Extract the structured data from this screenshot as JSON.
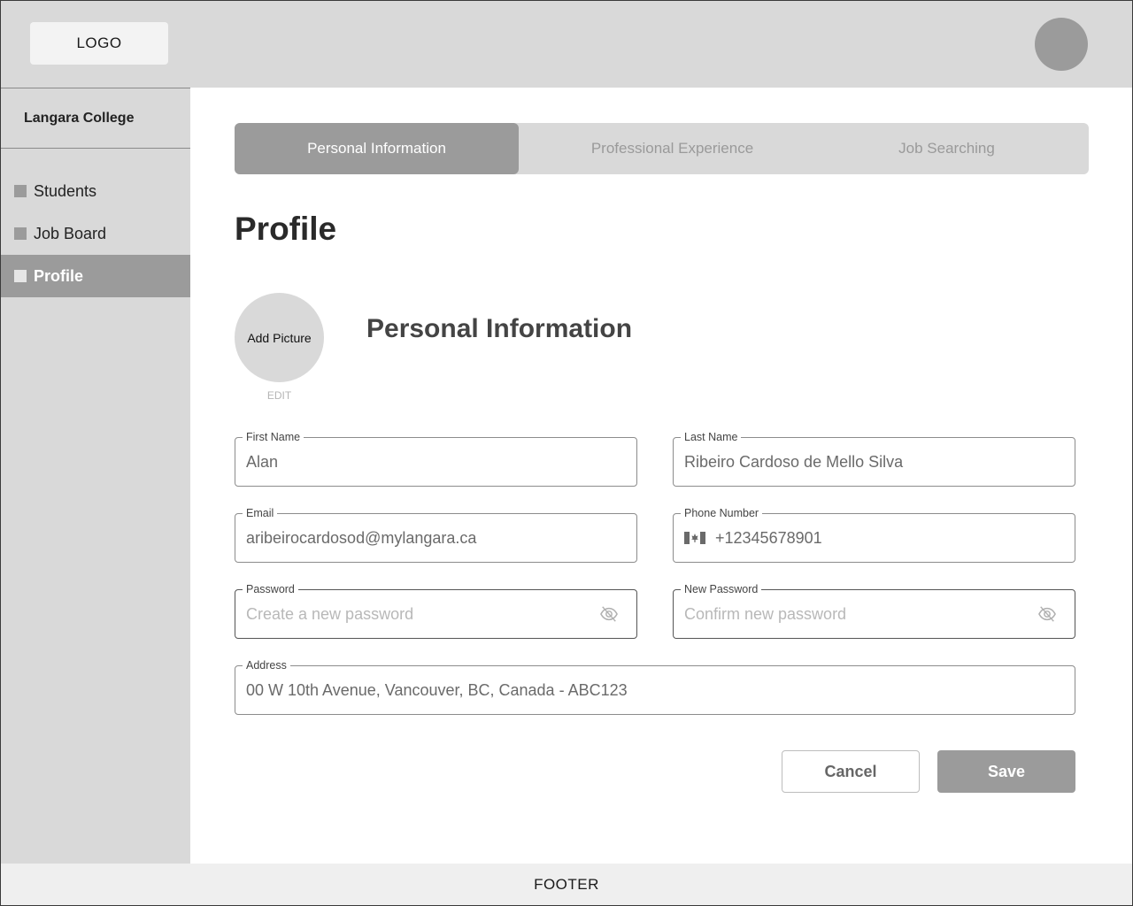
{
  "header": {
    "logo": "LOGO"
  },
  "sidebar": {
    "org_name": "Langara College",
    "items": [
      {
        "label": "Students",
        "active": false
      },
      {
        "label": "Job Board",
        "active": false
      },
      {
        "label": "Profile",
        "active": true
      }
    ]
  },
  "tabs": [
    {
      "label": "Personal Information",
      "active": true
    },
    {
      "label": "Professional Experience",
      "active": false
    },
    {
      "label": "Job Searching",
      "active": false
    }
  ],
  "page_title": "Profile",
  "picture": {
    "label": "Add Picture",
    "edit": "EDIT"
  },
  "section_title": "Personal Information",
  "form": {
    "first_name": {
      "label": "First Name",
      "value": "Alan"
    },
    "last_name": {
      "label": "Last Name",
      "value": "Ribeiro Cardoso de Mello Silva"
    },
    "email": {
      "label": "Email",
      "value": "aribeirocardosod@mylangara.ca"
    },
    "phone": {
      "label": "Phone Number",
      "value": "+12345678901",
      "country_flag": "canada-flag-icon"
    },
    "password": {
      "label": "Password",
      "value": "",
      "placeholder": "Create a new password"
    },
    "new_password": {
      "label": "New Password",
      "value": "",
      "placeholder": "Confirm new password"
    },
    "address": {
      "label": "Address",
      "value": "00 W 10th Avenue, Vancouver, BC, Canada - ABC123"
    }
  },
  "buttons": {
    "cancel": "Cancel",
    "save": "Save"
  },
  "footer": "FOOTER"
}
